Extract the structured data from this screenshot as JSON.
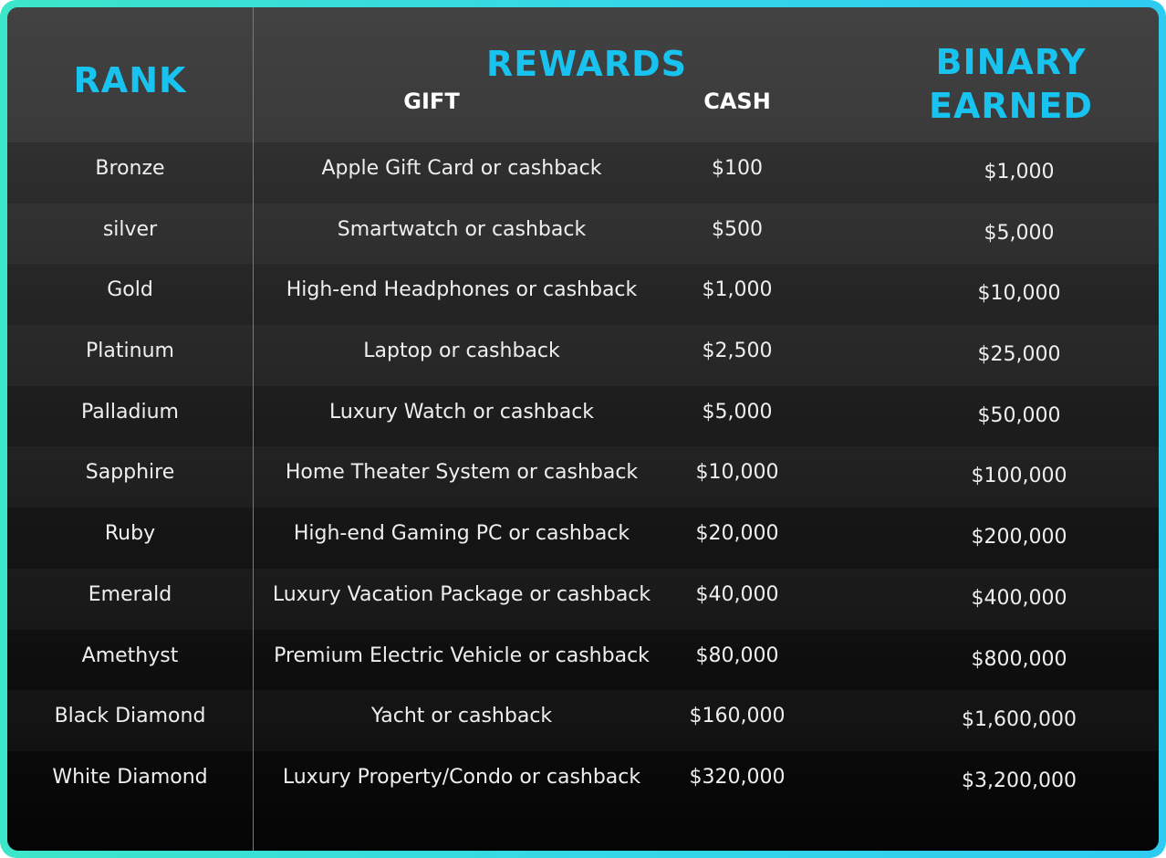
{
  "header": {
    "rank": "RANK",
    "rewards": "REWARDS",
    "gift": "GIFT",
    "cash": "CASH",
    "binary_line1": "BINARY",
    "binary_line2": "EARNED"
  },
  "rows": [
    {
      "rank": "Bronze",
      "gift": "Apple Gift Card or cashback",
      "cash": "$100",
      "binary": "$1,000"
    },
    {
      "rank": "silver",
      "gift": "Smartwatch or cashback",
      "cash": "$500",
      "binary": "$5,000"
    },
    {
      "rank": "Gold",
      "gift": "High-end Headphones or cashback",
      "cash": "$1,000",
      "binary": "$10,000"
    },
    {
      "rank": "Platinum",
      "gift": "Laptop or cashback",
      "cash": "$2,500",
      "binary": "$25,000"
    },
    {
      "rank": "Palladium",
      "gift": "Luxury Watch or cashback",
      "cash": "$5,000",
      "binary": "$50,000"
    },
    {
      "rank": "Sapphire",
      "gift": "Home Theater System or cashback",
      "cash": "$10,000",
      "binary": "$100,000"
    },
    {
      "rank": "Ruby",
      "gift": "High-end Gaming PC or cashback",
      "cash": "$20,000",
      "binary": "$200,000"
    },
    {
      "rank": "Emerald",
      "gift": "Luxury Vacation Package or cashback",
      "cash": "$40,000",
      "binary": "$400,000"
    },
    {
      "rank": "Amethyst",
      "gift": "Premium Electric Vehicle or cashback",
      "cash": "$80,000",
      "binary": "$800,000"
    },
    {
      "rank": "Black Diamond",
      "gift": "Yacht or cashback",
      "cash": "$160,000",
      "binary": "$1,600,000"
    },
    {
      "rank": "White Diamond",
      "gift": "Luxury Property/Condo or cashback",
      "cash": "$320,000",
      "binary": "$3,200,000"
    }
  ],
  "colors": {
    "accent": "#19c3ef",
    "border_gradient_start": "#3ce6c8",
    "border_gradient_end": "#2ecbf0"
  }
}
